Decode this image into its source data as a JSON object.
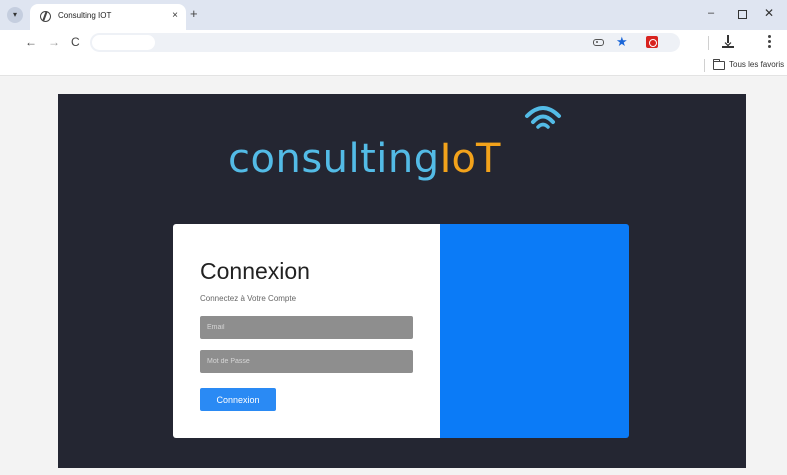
{
  "browser": {
    "tab": {
      "title": "Consulting IOT",
      "close": "×"
    },
    "new_tab": "+",
    "window": {
      "minimize": "–",
      "close": "✕"
    },
    "nav": {
      "back": "←",
      "forward": "→",
      "reload": "C"
    },
    "address_value": "",
    "star": "★",
    "bookmarks": {
      "all_bookmarks_label": "Tous les favoris"
    }
  },
  "page": {
    "logo": {
      "main": "consulting",
      "accent": "IoT",
      "main_color": "#53bbe6",
      "accent_color": "#f2a21b"
    },
    "login": {
      "title": "Connexion",
      "subtitle": "Connectez à Votre Compte",
      "email_placeholder": "Email",
      "password_placeholder": "Mot de Passe",
      "submit_label": "Connexion"
    },
    "colors": {
      "hero_bg": "#242632",
      "panel_blue": "#0b7bf7",
      "button_blue": "#2a8af4"
    }
  }
}
